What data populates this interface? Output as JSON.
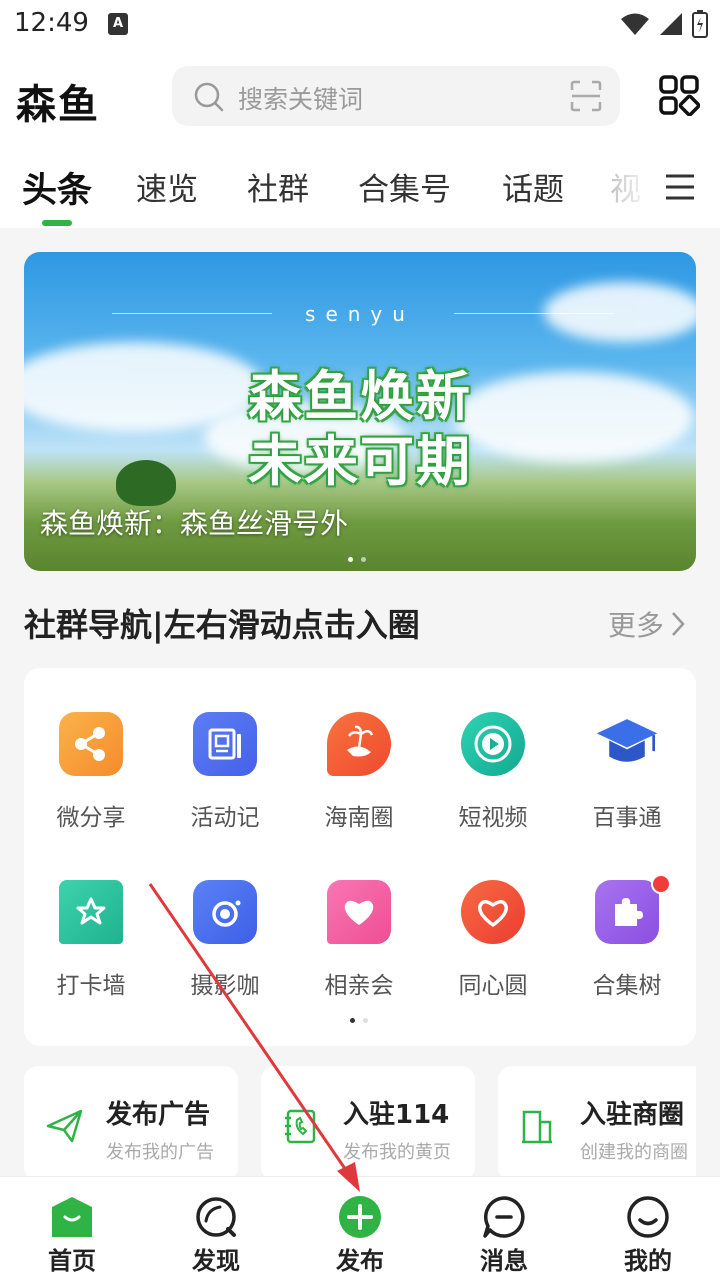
{
  "status_bar": {
    "time": "12:49",
    "notification_letter": "A"
  },
  "header": {
    "logo": "森鱼",
    "search_placeholder": "搜索关键词"
  },
  "tabs": [
    {
      "label": "头条",
      "active": true
    },
    {
      "label": "速览"
    },
    {
      "label": "社群"
    },
    {
      "label": "合集号"
    },
    {
      "label": "话题"
    },
    {
      "label": "视"
    }
  ],
  "banner": {
    "brand": "senyu",
    "headline_line1": "森鱼焕新",
    "headline_line2": "未来可期",
    "caption": "森鱼焕新：森鱼丝滑号外"
  },
  "section": {
    "title": "社群导航|左右滑动点击入圈",
    "more": "更多"
  },
  "communities": [
    {
      "label": "微分享",
      "icon": "share-icon",
      "color": "#f7a23a"
    },
    {
      "label": "活动记",
      "icon": "notebook-icon",
      "color": "#4e6ef2"
    },
    {
      "label": "海南圈",
      "icon": "island-icon",
      "color": "#f2593a"
    },
    {
      "label": "短视频",
      "icon": "play-icon",
      "color": "#1fbfa6"
    },
    {
      "label": "百事通",
      "icon": "graduation-cap-icon",
      "color": "#3a6ee8"
    },
    {
      "label": "打卡墙",
      "icon": "star-bookmark-icon",
      "color": "#2fc6a2"
    },
    {
      "label": "摄影咖",
      "icon": "camera-icon",
      "color": "#4e73f0"
    },
    {
      "label": "相亲会",
      "icon": "heart-chat-icon",
      "color": "#f25c9c"
    },
    {
      "label": "同心圆",
      "icon": "heart-circle-icon",
      "color": "#f2553a"
    },
    {
      "label": "合集树",
      "icon": "puzzle-icon",
      "color": "#9a5de8"
    }
  ],
  "services": [
    {
      "title": "发布广告",
      "subtitle": "发布我的广告",
      "icon": "paper-plane-icon"
    },
    {
      "title": "入驻114",
      "subtitle": "发布我的黄页",
      "icon": "phone-book-icon"
    },
    {
      "title": "入驻商圈",
      "subtitle": "创建我的商圈",
      "icon": "building-icon"
    }
  ],
  "bottom_nav": [
    {
      "label": "首页",
      "icon": "home-icon",
      "active": true
    },
    {
      "label": "发现",
      "icon": "discover-icon"
    },
    {
      "label": "发布",
      "icon": "publish-plus-icon"
    },
    {
      "label": "消息",
      "icon": "message-icon"
    },
    {
      "label": "我的",
      "icon": "profile-icon"
    }
  ],
  "colors": {
    "accent": "#2fb344",
    "annotation": "#e0393b"
  }
}
